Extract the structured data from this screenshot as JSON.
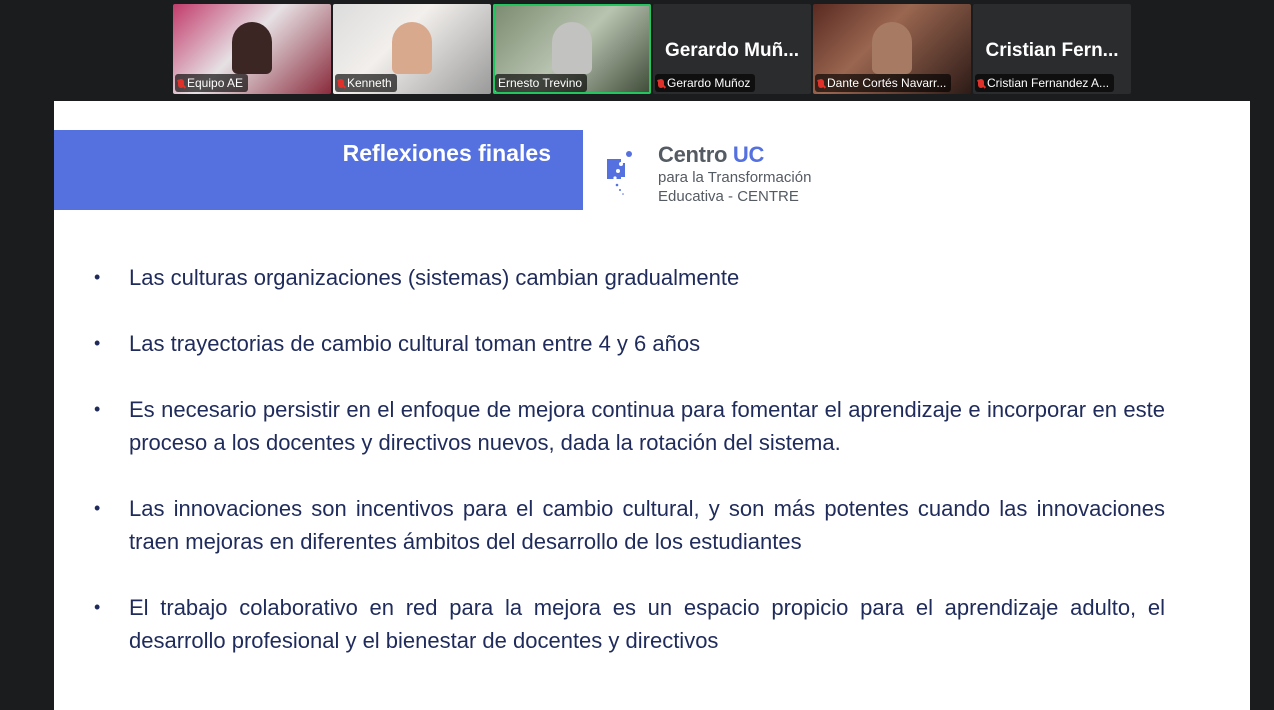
{
  "participants": [
    {
      "label": "Equipo AE",
      "big_name": ""
    },
    {
      "label": "Kenneth",
      "big_name": ""
    },
    {
      "label": "Ernesto Trevino",
      "big_name": ""
    },
    {
      "label": "Gerardo Muñoz",
      "big_name": "Gerardo Muñ..."
    },
    {
      "label": "Dante Cortés Navarr...",
      "big_name": ""
    },
    {
      "label": "Cristian Fernandez A...",
      "big_name": "Cristian Fern..."
    }
  ],
  "slide": {
    "title": "Reflexiones finales",
    "logo": {
      "line1_a": "Centro ",
      "line1_b": "UC",
      "line2": "para la Transformación",
      "line3": "Educativa - CENTRE"
    },
    "bullet_symbol": "•",
    "bullets": [
      "Las culturas organizaciones (sistemas) cambian gradualmente",
      "Las trayectorias de cambio cultural toman entre 4 y 6 años",
      "Es necesario persistir en el enfoque de mejora continua para fomentar el aprendizaje e incorporar en este proceso a los docentes y directivos nuevos, dada la rotación del sistema.",
      "Las innovaciones son incentivos para el cambio cultural, y son más potentes cuando las innovaciones traen mejoras en diferentes ámbitos del desarrollo de los estudiantes",
      "El trabajo colaborativo en red para la mejora es un espacio propicio para el aprendizaje adulto, el desarrollo profesional y el bienestar de docentes y directivos"
    ]
  },
  "colors": {
    "title_bar": "#5571e0",
    "bullet_text": "#1f2b5b",
    "active_speaker_border": "#22c55e",
    "muted_mic": "#e0302a"
  }
}
